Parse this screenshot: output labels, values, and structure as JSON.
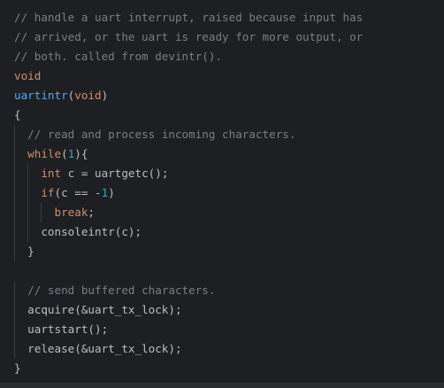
{
  "code": {
    "lines": [
      [
        {
          "t": "// handle a uart interrupt, raised because input has",
          "c": "cm"
        }
      ],
      [
        {
          "t": "// arrived, or the uart is ready for more output, or",
          "c": "cm"
        }
      ],
      [
        {
          "t": "// both. called from devintr().",
          "c": "cm"
        }
      ],
      [
        {
          "t": "void",
          "c": "kw"
        }
      ],
      [
        {
          "t": "uartintr",
          "c": "fn"
        },
        {
          "t": "(",
          "c": ""
        },
        {
          "t": "void",
          "c": "kw"
        },
        {
          "t": ")",
          "c": ""
        }
      ],
      [
        {
          "t": "{",
          "c": ""
        }
      ],
      [
        {
          "t": "  ",
          "c": ""
        },
        {
          "t": "// read and process incoming characters.",
          "c": "cm"
        }
      ],
      [
        {
          "t": "  ",
          "c": ""
        },
        {
          "t": "while",
          "c": "kw"
        },
        {
          "t": "(",
          "c": ""
        },
        {
          "t": "1",
          "c": "num"
        },
        {
          "t": "){",
          "c": ""
        }
      ],
      [
        {
          "t": "    ",
          "c": ""
        },
        {
          "t": "int",
          "c": "kw"
        },
        {
          "t": " c = uartgetc();",
          "c": ""
        }
      ],
      [
        {
          "t": "    ",
          "c": ""
        },
        {
          "t": "if",
          "c": "kw"
        },
        {
          "t": "(c == -",
          "c": ""
        },
        {
          "t": "1",
          "c": "num"
        },
        {
          "t": ")",
          "c": ""
        }
      ],
      [
        {
          "t": "      ",
          "c": ""
        },
        {
          "t": "break",
          "c": "kw"
        },
        {
          "t": ";",
          "c": ""
        }
      ],
      [
        {
          "t": "    consoleintr(c);",
          "c": ""
        }
      ],
      [
        {
          "t": "  }",
          "c": ""
        }
      ],
      [],
      [
        {
          "t": "  ",
          "c": ""
        },
        {
          "t": "// send buffered characters.",
          "c": "cm"
        }
      ],
      [
        {
          "t": "  acquire(&uart_tx_lock);",
          "c": ""
        }
      ],
      [
        {
          "t": "  uartstart();",
          "c": ""
        }
      ],
      [
        {
          "t": "  release(&uart_tx_lock);",
          "c": ""
        }
      ],
      [
        {
          "t": "}",
          "c": ""
        }
      ]
    ]
  },
  "colors": {
    "background": "#1e1f22",
    "comment": "#7a7e85",
    "keyword": "#cf8e6d",
    "function": "#56a8f5",
    "number": "#2aacb8",
    "text": "#bcbec4"
  }
}
